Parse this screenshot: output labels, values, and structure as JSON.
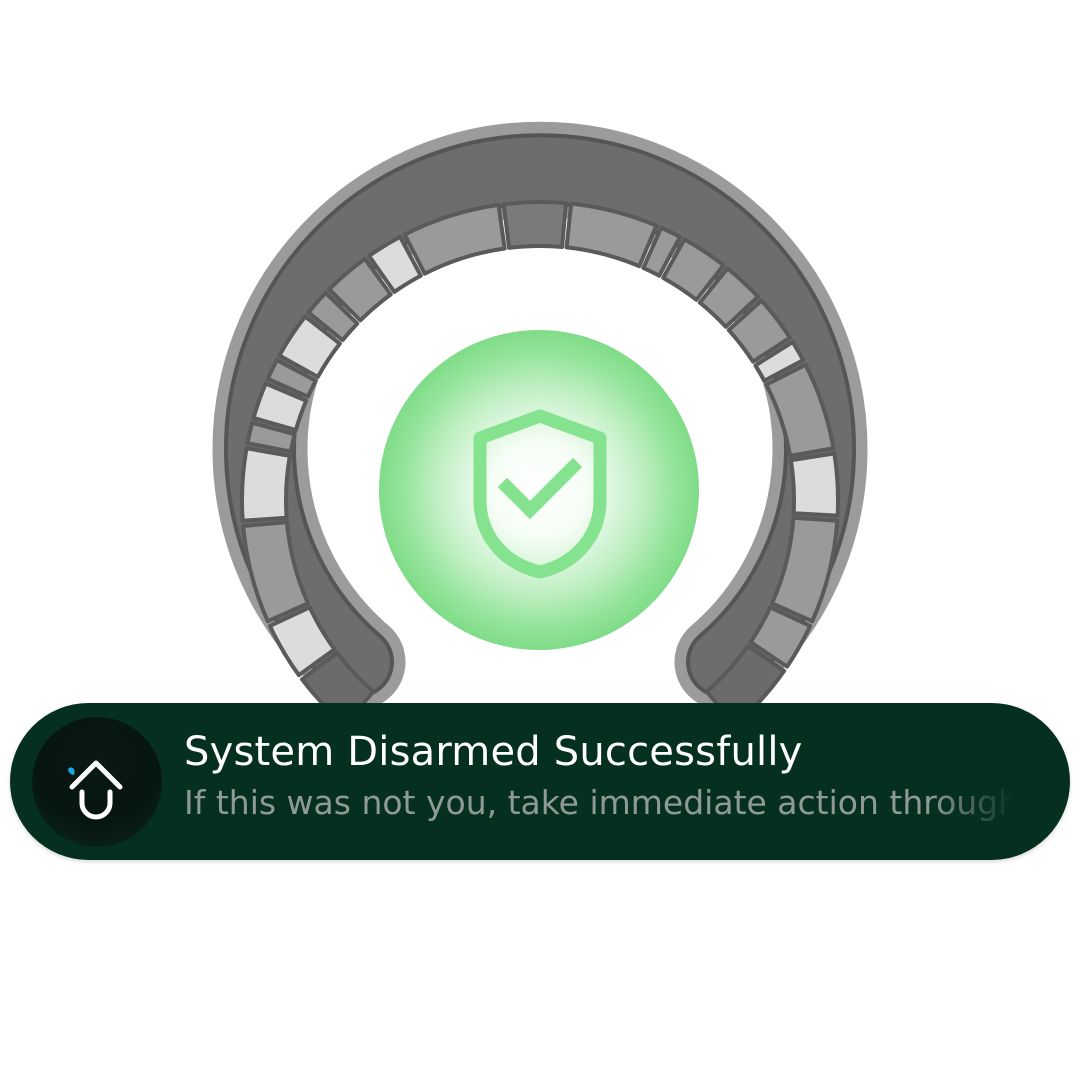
{
  "notification": {
    "title": "System Disarmed Successfully",
    "body": "If this was not you, take immediate action through the app",
    "app_icon": "home-app-icon"
  },
  "status_dial": {
    "state_icon": "shield-check-icon",
    "glow_color": "#85e28e",
    "dial_color": "#9b9b9b"
  }
}
